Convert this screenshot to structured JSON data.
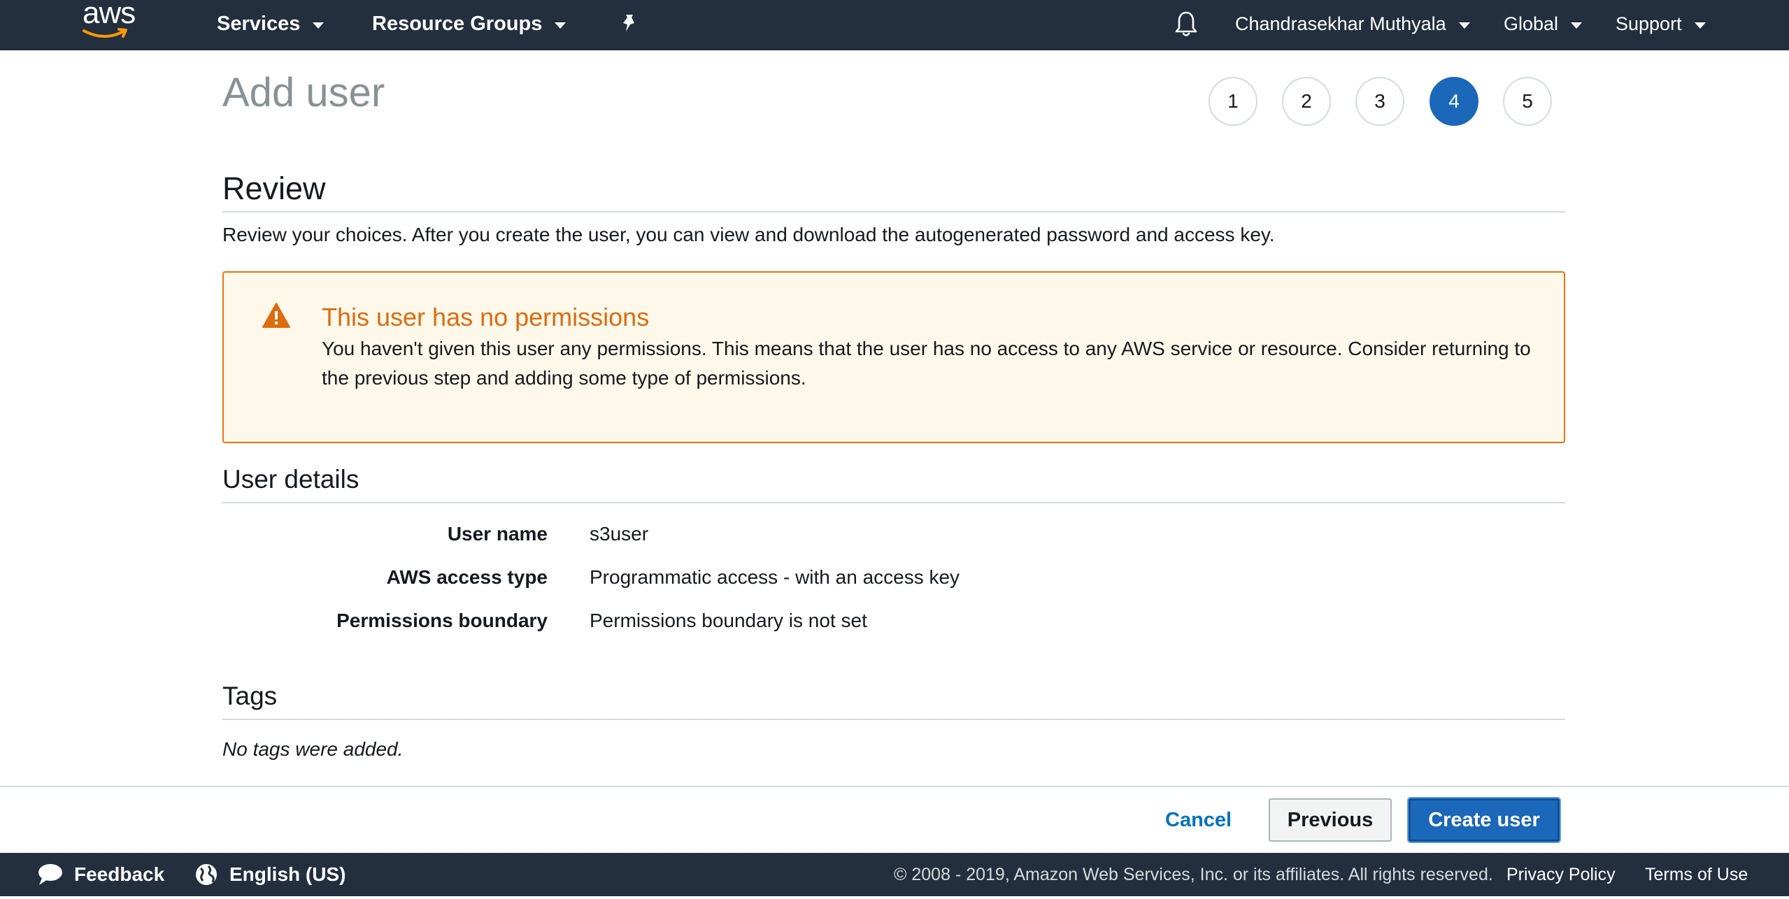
{
  "topnav": {
    "logo_text": "aws",
    "services": "Services",
    "resource_groups": "Resource Groups",
    "user": "Chandrasekhar Muthyala",
    "region": "Global",
    "support": "Support"
  },
  "page": {
    "title": "Add user",
    "steps": [
      "1",
      "2",
      "3",
      "4",
      "5"
    ],
    "active_step": "4"
  },
  "review": {
    "heading": "Review",
    "description": "Review your choices. After you create the user, you can view and download the autogenerated password and access key."
  },
  "alert": {
    "title": "This user has no permissions",
    "text": "You haven't given this user any permissions. This means that the user has no access to any AWS service or resource. Consider returning to the previous step and adding some type of permissions."
  },
  "user_details": {
    "heading": "User details",
    "rows": [
      {
        "label": "User name",
        "value": "s3user"
      },
      {
        "label": "AWS access type",
        "value": "Programmatic access - with an access key"
      },
      {
        "label": "Permissions boundary",
        "value": "Permissions boundary is not set"
      }
    ]
  },
  "tags": {
    "heading": "Tags",
    "empty": "No tags were added."
  },
  "actions": {
    "cancel": "Cancel",
    "previous": "Previous",
    "create": "Create user"
  },
  "footer": {
    "feedback": "Feedback",
    "language": "English (US)",
    "copyright": "© 2008 - 2019, Amazon Web Services, Inc. or its affiliates. All rights reserved.",
    "privacy": "Privacy Policy",
    "terms": "Terms of Use"
  },
  "colors": {
    "nav_bg": "#232f3e",
    "accent_blue": "#1b67b9",
    "warning_orange": "#dd6b10",
    "alert_bg": "#fef8ea",
    "link_blue": "#0073bb"
  },
  "icons": {
    "notifications": "bell-icon",
    "pin": "pin-icon",
    "warning": "warning-triangle-icon",
    "feedback": "speech-bubble-icon",
    "language": "globe-icon"
  }
}
